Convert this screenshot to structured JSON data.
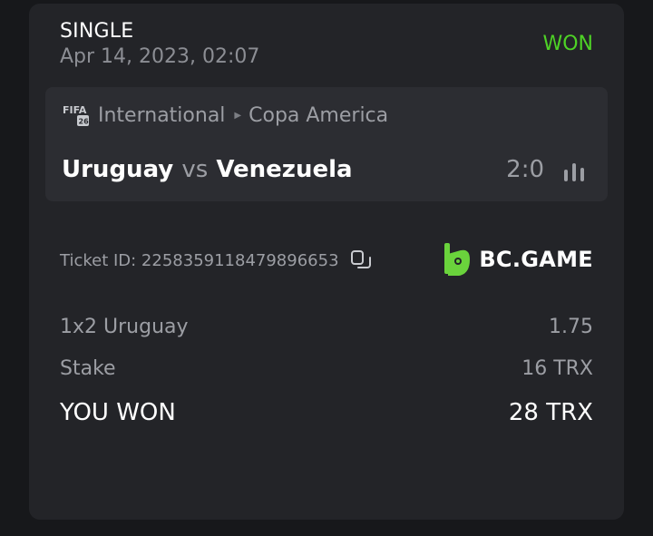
{
  "bet": {
    "type": "SINGLE",
    "date": "Apr 14, 2023, 02:07",
    "status": "WON",
    "status_color": "#4ed226"
  },
  "event": {
    "sport_icon": "fifa-logo-icon",
    "sport_icon_text": "FIFA 26",
    "category": "International",
    "separator_icon": "caret-right-icon",
    "league": "Copa America",
    "home": "Uruguay",
    "vs": "vs",
    "away": "Venezuela",
    "score": "2:0",
    "stats_icon": "stats-bars-icon"
  },
  "ticket": {
    "id_label": "Ticket ID: 2258359118479896653",
    "copy_icon": "copy-icon"
  },
  "brand": {
    "name": "BC.GAME",
    "accent": "#6ad33c"
  },
  "details": [
    {
      "label": "1x2 Uruguay",
      "value": "1.75"
    },
    {
      "label": "Stake",
      "value": "16 TRX"
    },
    {
      "label": "YOU WON",
      "value": "28 TRX"
    }
  ]
}
